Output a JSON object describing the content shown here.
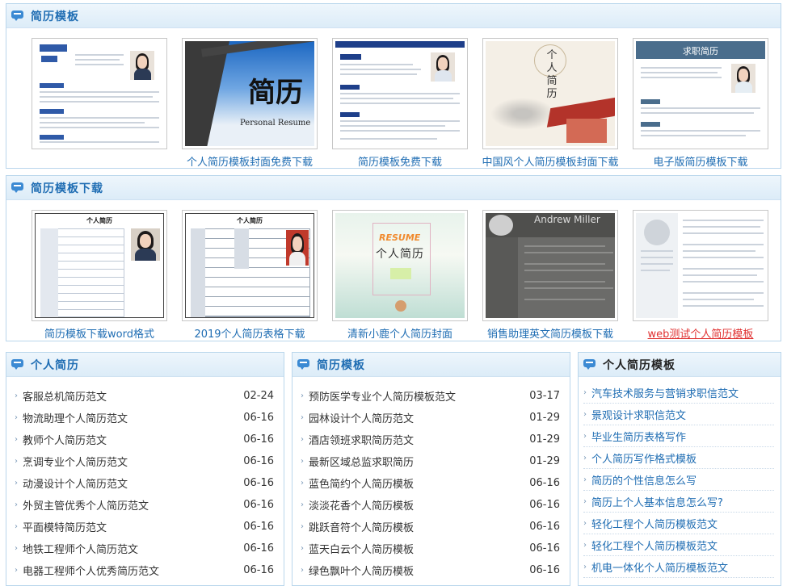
{
  "section1": {
    "title": "简历模板",
    "items": [
      {
        "caption": ""
      },
      {
        "caption": "个人简历模板封面免费下载",
        "cover_text": "简历",
        "cover_en": "Personal Resume"
      },
      {
        "caption": "简历模板免费下载"
      },
      {
        "caption": "中国风个人简历模板封面下载",
        "cover_text": "个人简历"
      },
      {
        "caption": "电子版简历模板下载",
        "cover_text": "求职简历"
      }
    ]
  },
  "section2": {
    "title": "简历模板下载",
    "items": [
      {
        "caption": "简历模板下载word格式",
        "doc_title": "个人简历"
      },
      {
        "caption": "2019个人简历表格下载",
        "doc_title": "个人简历"
      },
      {
        "caption": "清新小鹿个人简历封面",
        "cover_text": "个人简历",
        "badge": "RESUME"
      },
      {
        "caption": "销售助理英文简历模板下载",
        "cover_name": "Andrew Miller"
      },
      {
        "caption": "web测试个人简历模板"
      }
    ]
  },
  "list1": {
    "title": "个人简历",
    "items": [
      {
        "title": "客服总机简历范文",
        "date": "02-24"
      },
      {
        "title": "物流助理个人简历范文",
        "date": "06-16"
      },
      {
        "title": "教师个人简历范文",
        "date": "06-16"
      },
      {
        "title": "烹调专业个人简历范文",
        "date": "06-16"
      },
      {
        "title": "动漫设计个人简历范文",
        "date": "06-16"
      },
      {
        "title": "外贸主管优秀个人简历范文",
        "date": "06-16"
      },
      {
        "title": "平面模特简历范文",
        "date": "06-16"
      },
      {
        "title": "地铁工程师个人简历范文",
        "date": "06-16"
      },
      {
        "title": "电器工程师个人优秀简历范文",
        "date": "06-16"
      }
    ]
  },
  "list2": {
    "title": "简历模板",
    "items": [
      {
        "title": "预防医学专业个人简历模板范文",
        "date": "03-17"
      },
      {
        "title": "园林设计个人简历范文",
        "date": "01-29"
      },
      {
        "title": "酒店领班求职简历范文",
        "date": "01-29"
      },
      {
        "title": "最新区域总监求职简历",
        "date": "01-29"
      },
      {
        "title": "蓝色简约个人简历模板",
        "date": "06-16"
      },
      {
        "title": "淡淡花香个人简历模板",
        "date": "06-16"
      },
      {
        "title": "跳跃音符个人简历模板",
        "date": "06-16"
      },
      {
        "title": "蓝天白云个人简历模板",
        "date": "06-16"
      },
      {
        "title": "绿色飘叶个人简历模板",
        "date": "06-16"
      }
    ]
  },
  "list3": {
    "title": "个人简历模板",
    "items": [
      {
        "title": "汽车技术服务与营销求职信范文"
      },
      {
        "title": "景观设计求职信范文"
      },
      {
        "title": "毕业生简历表格写作"
      },
      {
        "title": "个人简历写作格式模板"
      },
      {
        "title": "简历的个性信息怎么写"
      },
      {
        "title": "简历上个人基本信息怎么写?"
      },
      {
        "title": "轻化工程个人简历模板范文"
      },
      {
        "title": "轻化工程个人简历模板范文"
      },
      {
        "title": "机电一体化个人简历模板范文"
      }
    ]
  },
  "colors": {
    "accent": "#1f6db3",
    "border": "#b9d6ec",
    "highlight_link": "#e03030"
  }
}
